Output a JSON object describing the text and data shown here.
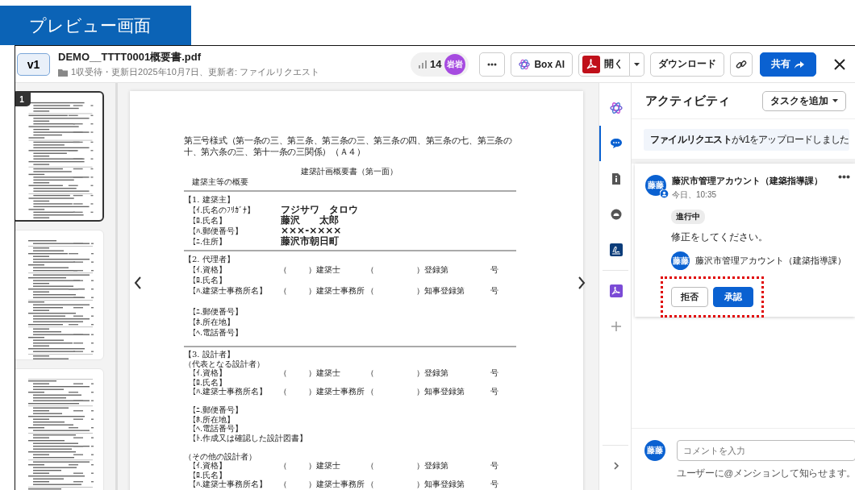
{
  "page_label": "プレビュー画面",
  "header": {
    "version": "v1",
    "file_name": "DEMO__TTTT0001概要書.pdf",
    "file_meta": "1収受待・更新日2025年10月7日、更新者: ファイルリクエスト",
    "view_count": "14",
    "viewer_avatar": "岩岩",
    "buttons": [
      {
        "kind": "more"
      },
      {
        "kind": "ai",
        "label": "Box AI"
      },
      {
        "kind": "open",
        "label": "開く"
      },
      {
        "kind": "caret"
      },
      {
        "kind": "plain",
        "label": "ダウンロード"
      },
      {
        "kind": "link"
      },
      {
        "kind": "share",
        "label": "共有"
      },
      {
        "kind": "close"
      }
    ]
  },
  "thumbnails": [
    {
      "number": "1",
      "selected": true
    },
    {
      "selected": false
    },
    {
      "selected": false
    }
  ],
  "document": {
    "lines": [
      {
        "kind": "para",
        "text": "第三号様式（第一条の三、第三条、第三条の三、第三条の四、第三条の七、第三条の十、第六条の三、第十一条の三関係）（Ａ４）"
      },
      {
        "kind": "title",
        "text": "建築計画概要書（第一面）"
      },
      {
        "kind": "text",
        "text": "建築主等の概要"
      },
      {
        "kind": "rule"
      },
      {
        "kind": "section",
        "text": "【1. 建築主】"
      },
      {
        "kind": "field",
        "label": "【ｲ.氏名のﾌﾘｶﾞﾅ】",
        "value": "フジサワ　タロウ"
      },
      {
        "kind": "field",
        "label": "【ﾛ.氏名】",
        "value": "藤沢　　太郎"
      },
      {
        "kind": "field",
        "label": "【ﾊ.郵便番号】",
        "value": "×××-××××"
      },
      {
        "kind": "field",
        "label": "【ﾆ.住所】",
        "value": "藤沢市朝日町"
      },
      {
        "kind": "rule"
      },
      {
        "kind": "section",
        "text": "【2. 代理者】"
      },
      {
        "kind": "form",
        "label": "【ｲ.資格】",
        "cells": [
          "（",
          "）建築士",
          "（",
          "）登録第",
          "号"
        ]
      },
      {
        "kind": "field",
        "label": "【ﾛ.氏名】"
      },
      {
        "kind": "form",
        "label": "【ﾊ.建築士事務所名】",
        "cells": [
          "（",
          "）建築士事務所",
          "（",
          "）知事登録第",
          "号"
        ]
      },
      {
        "kind": "gap"
      },
      {
        "kind": "field",
        "label": "【ﾆ.郵便番号】"
      },
      {
        "kind": "field",
        "label": "【ﾎ.所在地】"
      },
      {
        "kind": "field",
        "label": "【ﾍ.電話番号】"
      },
      {
        "kind": "rule"
      },
      {
        "kind": "section",
        "text": "【3. 設計者】"
      },
      {
        "kind": "section",
        "text": "（代表となる設計者）"
      },
      {
        "kind": "form",
        "label": "【ｲ.資格】",
        "cells": [
          "（",
          "）建築士",
          "（",
          "）登録第",
          "号"
        ]
      },
      {
        "kind": "field",
        "label": "【ﾛ.氏名】"
      },
      {
        "kind": "form",
        "label": "【ﾊ.建築士事務所名】",
        "cells": [
          "（",
          "）建築士事務所",
          "（",
          "）知事登録第",
          "号"
        ]
      },
      {
        "kind": "gap"
      },
      {
        "kind": "field",
        "label": "【ﾆ.郵便番号】"
      },
      {
        "kind": "field",
        "label": "【ﾎ.所在地】"
      },
      {
        "kind": "field",
        "label": "【ﾍ.電話番号】"
      },
      {
        "kind": "field",
        "label": "【ﾄ.作成又は確認した設計図書】"
      },
      {
        "kind": "gap"
      },
      {
        "kind": "section",
        "text": "（その他の設計者）"
      },
      {
        "kind": "form",
        "label": "【ｲ.資格】",
        "cells": [
          "（",
          "）建築士",
          "（",
          "）登録第",
          "号"
        ]
      },
      {
        "kind": "field",
        "label": "【ﾛ.氏名】"
      },
      {
        "kind": "form",
        "label": "【ﾊ.建築士事務所名】",
        "cells": [
          "（",
          "）建築士事務所",
          "（",
          "）知事登録第",
          "号"
        ]
      }
    ]
  },
  "sidebar": {
    "apps": [
      {
        "kind": "ai",
        "selected": false
      },
      {
        "kind": "comments",
        "selected": true
      },
      {
        "kind": "details",
        "selected": false
      },
      {
        "kind": "faces",
        "selected": false
      },
      {
        "kind": "sign",
        "selected": false
      }
    ],
    "extras": [
      {
        "kind": "pdf",
        "selected": false
      },
      {
        "kind": "add",
        "selected": false
      }
    ]
  },
  "activity": {
    "title": "アクティビティ",
    "add_task": "タスクを追加",
    "notice": "**ファイルリクエスト**がv1をアップロードしました",
    "task": {
      "avatar": "藤藤",
      "author": "藤沢市管理アカウント（建築指導課）",
      "time": "今日、10:35",
      "status": "進行中",
      "message": "修正をしてください。",
      "assignees": [
        {
          "avatar": "藤藤",
          "name": "藤沢市管理アカウント（建築指導課）"
        }
      ],
      "actions": [
        {
          "kind": "secondary",
          "label": "拒否"
        },
        {
          "kind": "primary",
          "label": "承認"
        }
      ],
      "highlighted": true
    },
    "comment": {
      "avatar": "藤藤",
      "placeholder": "コメントを入力",
      "hint": "ユーザーに@メンションして知らせます。"
    }
  }
}
